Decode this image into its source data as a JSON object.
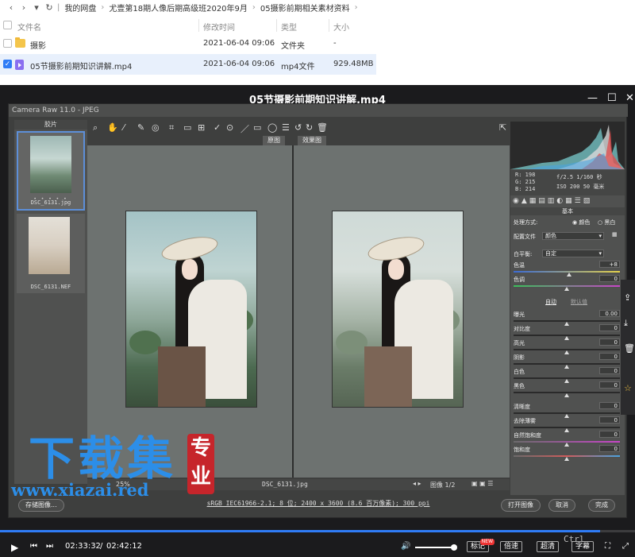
{
  "breadcrumb": {
    "items": [
      "我的网盘",
      "尤壹第18期人像后期高级班2020年9月",
      "05摄影前期相关素材资料"
    ]
  },
  "file_list": {
    "headers": {
      "name": "文件名",
      "modified": "修改时间",
      "type": "类型",
      "size": "大小"
    },
    "rows": [
      {
        "name": "摄影",
        "modified": "2021-06-04 09:06",
        "type": "文件夹",
        "size": "-",
        "selected": false,
        "icon": "folder-icon"
      },
      {
        "name": "05节摄影前期知识讲解.mp4",
        "modified": "2021-06-04 09:06",
        "type": "mp4文件",
        "size": "929.48MB",
        "selected": true,
        "icon": "video-file-icon"
      }
    ]
  },
  "player": {
    "title": "05节摄影前期知识讲解.mp4",
    "current_time": "02:33:32",
    "total_time": "02:42:12",
    "progress": 0.945,
    "buttons": {
      "mark": "标记",
      "speed": "倍速",
      "quality": "超清",
      "subtitle": "字幕"
    },
    "new_badge": "NEW"
  },
  "camera_raw": {
    "window_title": "Camera Raw 11.0 - JPEG",
    "filmstrip_label": "胶片",
    "thumbnails": [
      {
        "caption": "DSC_6131.jpg",
        "stars": "• • • • •"
      },
      {
        "caption": "DSC_6131.NEF"
      }
    ],
    "view_labels": {
      "before": "原图",
      "after": "效果图"
    },
    "footer_filename": "DSC_6131.jpg",
    "footer_zoom": "25%",
    "footer_pager": "图像 1/2",
    "status_line": "sRGB IEC61966-2.1; 8 位; 2400 x 3600 (8.6 百万像素); 300 ppi",
    "buttons": {
      "save": "存储图像...",
      "open": "打开图像",
      "cancel": "取消",
      "done": "完成"
    },
    "meta": {
      "r": "R: 198",
      "g": "G: 215",
      "b": "B: 214",
      "aperture": "f/2.5 1/160 秒",
      "iso": "ISO 200 50 毫米"
    },
    "panel": {
      "section": "基本",
      "treatment_label": "处理方式:",
      "treatment_color": "颜色",
      "treatment_bw": "黑白",
      "profile_label": "配置文件",
      "profile_value": "颜色",
      "wb_label": "白平衡:",
      "wb_value": "自定",
      "auto": "自动",
      "default": "默认值",
      "sliders": [
        {
          "label": "色温",
          "value": "+8",
          "level": 0.52
        },
        {
          "label": "色调",
          "value": "0",
          "level": 0.5
        },
        {
          "label": "曝光",
          "value": "0.00",
          "level": 0.5
        },
        {
          "label": "对比度",
          "value": "0",
          "level": 0.5
        },
        {
          "label": "高光",
          "value": "0",
          "level": 0.5
        },
        {
          "label": "阴影",
          "value": "0",
          "level": 0.5
        },
        {
          "label": "白色",
          "value": "0",
          "level": 0.5
        },
        {
          "label": "黑色",
          "value": "0",
          "level": 0.5
        },
        {
          "label": "清晰度",
          "value": "0",
          "level": 0.5
        },
        {
          "label": "去除薄雾",
          "value": "0",
          "level": 0.5
        },
        {
          "label": "自然饱和度",
          "value": "0",
          "level": 0.5
        },
        {
          "label": "饱和度",
          "value": "0",
          "level": 0.5
        }
      ]
    }
  },
  "watermark": {
    "big": "下载集",
    "seal": "专业",
    "url": "www.xiazai.red"
  },
  "overlay_key": "Ctrl",
  "colors": {
    "accent": "#2f7cf6",
    "watermark": "#2c8ee8",
    "seal": "#c6252b"
  }
}
